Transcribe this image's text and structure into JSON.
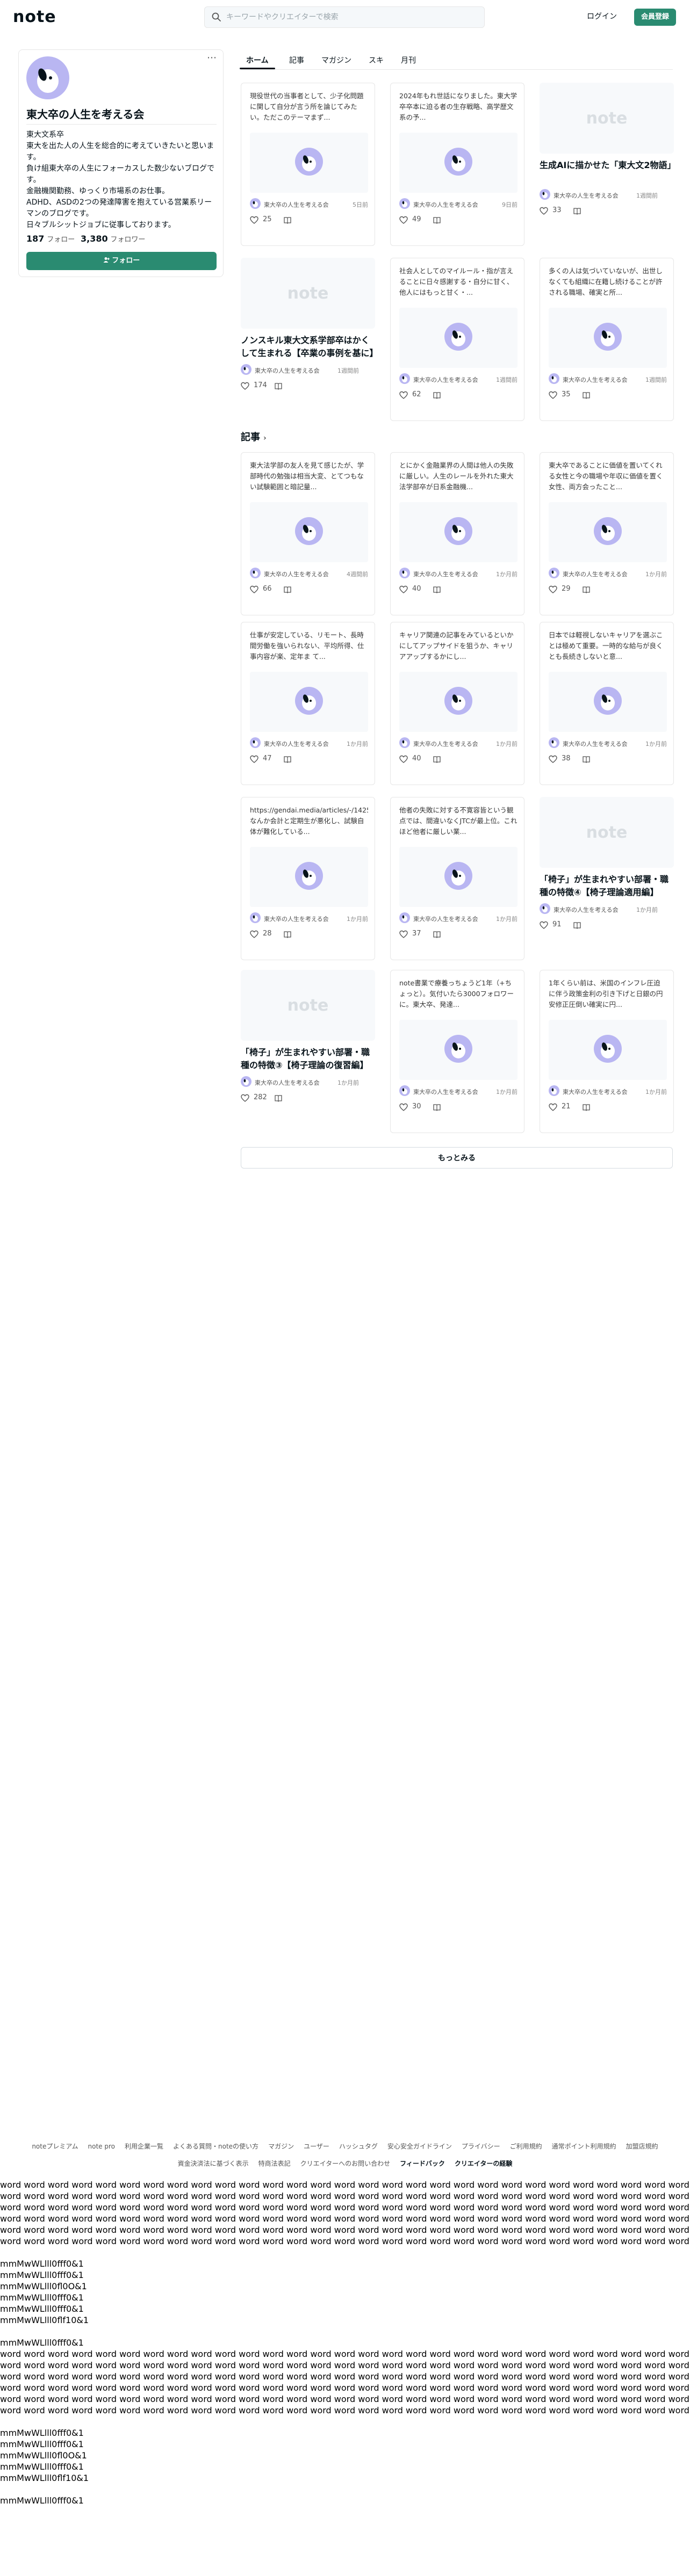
{
  "header": {
    "logo": "note",
    "search_placeholder": "キーワードやクリエイターで検索",
    "login_label": "ログイン",
    "signup_label": "会員登録"
  },
  "profile": {
    "name": "東大卒の人生を考える会",
    "bio": [
      "東大文系卒",
      "東大を出た人の人生を総合的に考えていきたいと思いま",
      "す。",
      "負け組東大卒の人生にフォーカスした数少ないブログで",
      "す。",
      "金融機関勤務、ゆっくり市場系のお仕事。",
      "ADHD、ASDの2つの発達障害を抱えている営業系リー",
      "マンのブログです。",
      "日々ブルシットジョブに従事しております。"
    ],
    "following_count": "187",
    "following_label": "フォロー",
    "followers_count": "3,380",
    "followers_label": "フォロワー",
    "follow_button": "フォロー"
  },
  "tabs": [
    {
      "label": "ホーム",
      "active": true
    },
    {
      "label": "記事",
      "active": false
    },
    {
      "label": "マガジン",
      "active": false
    },
    {
      "label": "スキ",
      "active": false
    },
    {
      "label": "月刊",
      "active": false
    }
  ],
  "cards_top": [
    {
      "excerpt": "現役世代の当事者として、少子化問題に関して自分が言う所を論じてみたい。ただこのテーマまず...",
      "author": "東大卒の人生を考える会",
      "time": "5日前",
      "likes": "25"
    },
    {
      "excerpt": "2024年もれ世話になりました。東大学卒卒本に迫る者の生存戦略、高学歴文系の予...",
      "author": "東大卒の人生を考える会",
      "time": "9日前",
      "likes": "49"
    },
    {
      "title": "生成AIに描かせた「東大文2物語」",
      "author": "東大卒の人生を考える会",
      "time": "1週間前",
      "likes": "33"
    },
    {
      "title": "ノンスキル東大文系学部卒はかくして生まれる【卒業の事例を基に】",
      "author": "東大卒の人生を考える会",
      "time": "1週間前",
      "likes": "174"
    },
    {
      "excerpt": "社会人としてのマイルール・指が言えることに日々感謝する・自分に甘く、他人にはもっと甘く・...",
      "author": "東大卒の人生を考える会",
      "time": "1週間前",
      "likes": "62"
    },
    {
      "excerpt": "多くの人は気づいていないが、出世しなくても組織に在籍し続けることが許される職場、確実と所...",
      "author": "東大卒の人生を考える会",
      "time": "1週間前",
      "likes": "35"
    }
  ],
  "section_articles": "記事",
  "cards_articles": [
    {
      "excerpt": "東大法学部の友人を見て感じたが、学部時代の勉強は相当大変、とてつもない試験範囲と暗記量...",
      "author": "東大卒の人生を考える会",
      "time": "4週間前",
      "likes": "66"
    },
    {
      "excerpt": "とにかく金融業界の人間は他人の失敗に厳しい。人生のレールを外れた東大法学部卒が日系金融機...",
      "author": "東大卒の人生を考える会",
      "time": "1か月前",
      "likes": "40"
    },
    {
      "excerpt": "東大卒であることに価値を置いてくれる女性と今の職場や年収に価値を置く女性、両方会ったこと...",
      "author": "東大卒の人生を考える会",
      "time": "1か月前",
      "likes": "29"
    },
    {
      "excerpt": "仕事が安定している、リモート、長時間労働を強いられない、平均所得、仕事内容が楽、定年ま て...",
      "author": "東大卒の人生を考える会",
      "time": "1か月前",
      "likes": "47"
    },
    {
      "excerpt": "キャリア関連の記事をみているといかにしてアップサイドを狙うか、キャリアアップするかにし...",
      "author": "東大卒の人生を考える会",
      "time": "1か月前",
      "likes": "40"
    },
    {
      "excerpt": "日本では軽視しないキャリアを選ぶことは極めて重要。一時的な給与が良くとも長続きしないと意...",
      "author": "東大卒の人生を考える会",
      "time": "1か月前",
      "likes": "38"
    },
    {
      "excerpt": "https://gendai.media/articles/-/142553 なんか会計と定期生が悪化し、試験自体が難化している...",
      "author": "東大卒の人生を考える会",
      "time": "1か月前",
      "likes": "28"
    },
    {
      "excerpt": "他者の失敗に対する不寛容皆という観点では、間違いなくJTCが最上位。これほど他者に厳しい業...",
      "author": "東大卒の人生を考える会",
      "time": "1か月前",
      "likes": "37"
    },
    {
      "title": "「椅子」が生まれやすい部署・職種の特徴④【椅子理論適用編】",
      "author": "東大卒の人生を考える会",
      "time": "1か月前",
      "likes": "91"
    },
    {
      "title": "「椅子」が生まれやすい部署・職種の特徴③【椅子理論の復習編】",
      "author": "東大卒の人生を考える会",
      "time": "1か月前",
      "likes": "282"
    },
    {
      "excerpt": "note書業で療養っちょうど1年（+ちょっと）。気付いたら3000フォロワーに。東大卒、発達...",
      "author": "東大卒の人生を考える会",
      "time": "1か月前",
      "likes": "30"
    },
    {
      "excerpt": "1年くらい前は、米国のインフレ圧迫に伴う政策金利の引き下げと日銀の円安修正圧倒い確実に円...",
      "author": "東大卒の人生を考える会",
      "time": "1か月前",
      "likes": "21"
    }
  ],
  "more_button": "もっとみる",
  "footer_row1": [
    "noteプレミアム",
    "note pro",
    "利用企業一覧",
    "よくある質問・noteの使い方",
    "マガジン",
    "ユーザー",
    "ハッシュタグ",
    "安心安全ガイドライン",
    "プライバシー",
    "ご利用規約",
    "通常ポイント利用規約",
    "加盟店規約"
  ],
  "footer_row2": [
    "資金決済法に基づく表示",
    "特商法表記",
    "クリエイターへのお問い合わせ",
    "フィードバック",
    "クリエイターの経験"
  ],
  "test_text": {
    "word_line": "word word word word word word word word word word word word word word word word word word word word word word word word word word word word word word word word word word word word word word word word word word word word word word word word word word word word word word",
    "word_line_last": "word word word word word word word word word word word word word word word word word word word word word word word word word word word word word word word word word word word word word word word word word word word word word word word word word word word word word word",
    "glyph1": "mmMwWLlll0fff0&1",
    "glyph2": "mmMwWLlll0fff0&1",
    "glyph3": "mmMwWLlll0fl0O&1",
    "glyph4": "mmMwWLlll0fff0&1",
    "glyph5": "mmMwWLlll0fff0&1",
    "glyph6": "mmMwWLlll0flf10&1"
  }
}
